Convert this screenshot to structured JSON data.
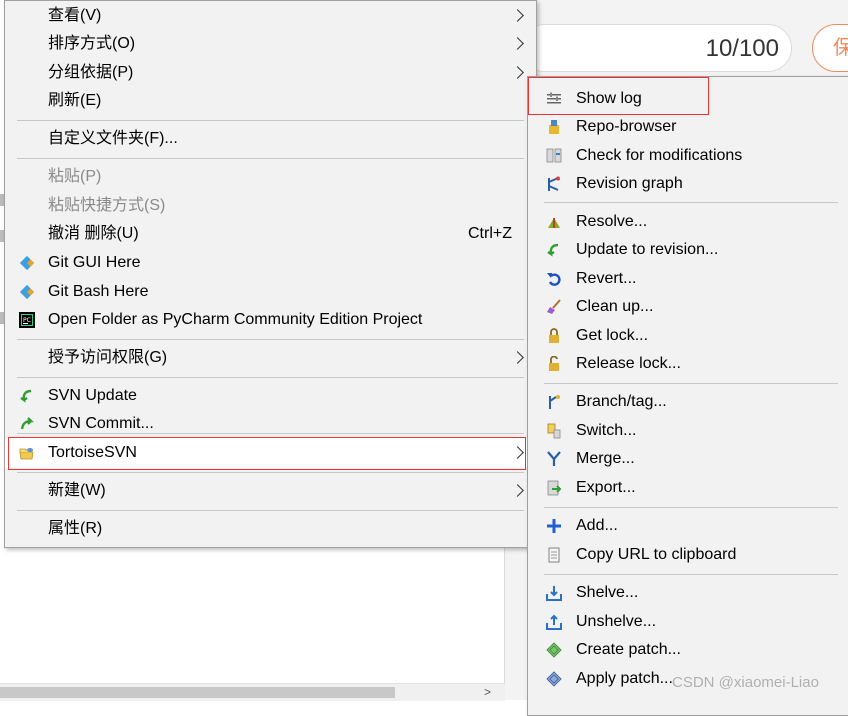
{
  "background": {
    "counter_text": "10/100",
    "save_button": "保"
  },
  "main_menu": [
    {
      "label": "查看(V)",
      "submenu": true
    },
    {
      "label": "排序方式(O)",
      "submenu": true
    },
    {
      "label": "分组依据(P)",
      "submenu": true
    },
    {
      "label": "刷新(E)"
    },
    {
      "label": "自定义文件夹(F)..."
    },
    {
      "label": "粘贴(P)",
      "disabled": true
    },
    {
      "label": "粘贴快捷方式(S)",
      "disabled": true
    },
    {
      "label": "撤消 删除(U)",
      "shortcut": "Ctrl+Z"
    },
    {
      "label": "Git GUI Here",
      "icon": "git-gui-icon"
    },
    {
      "label": "Git Bash Here",
      "icon": "git-bash-icon"
    },
    {
      "label": "Open Folder as PyCharm Community Edition Project",
      "icon": "pycharm-icon"
    },
    {
      "label": "授予访问权限(G)",
      "submenu": true
    },
    {
      "label": "SVN Update",
      "icon": "svn-update-icon"
    },
    {
      "label": "SVN Commit...",
      "icon": "svn-commit-icon"
    },
    {
      "label": "TortoiseSVN",
      "icon": "tortoisesvn-icon",
      "submenu": true,
      "highlighted": true
    },
    {
      "label": "新建(W)",
      "submenu": true
    },
    {
      "label": "属性(R)"
    }
  ],
  "svn_menu": [
    {
      "label": "Show log",
      "icon": "show-log-icon",
      "highlighted": true
    },
    {
      "label": "Repo-browser",
      "icon": "repo-browser-icon"
    },
    {
      "label": "Check for modifications",
      "icon": "check-modifications-icon"
    },
    {
      "label": "Revision graph",
      "icon": "revision-graph-icon"
    },
    {
      "label": "Resolve...",
      "icon": "resolve-icon"
    },
    {
      "label": "Update to revision...",
      "icon": "update-revision-icon"
    },
    {
      "label": "Revert...",
      "icon": "revert-icon"
    },
    {
      "label": "Clean up...",
      "icon": "cleanup-icon"
    },
    {
      "label": "Get lock...",
      "icon": "get-lock-icon"
    },
    {
      "label": "Release lock...",
      "icon": "release-lock-icon"
    },
    {
      "label": "Branch/tag...",
      "icon": "branch-tag-icon"
    },
    {
      "label": "Switch...",
      "icon": "switch-icon"
    },
    {
      "label": "Merge...",
      "icon": "merge-icon"
    },
    {
      "label": "Export...",
      "icon": "export-icon"
    },
    {
      "label": "Add...",
      "icon": "add-icon"
    },
    {
      "label": "Copy URL to clipboard",
      "icon": "copy-url-icon"
    },
    {
      "label": "Shelve...",
      "icon": "shelve-icon"
    },
    {
      "label": "Unshelve...",
      "icon": "unshelve-icon"
    },
    {
      "label": "Create patch...",
      "icon": "create-patch-icon"
    },
    {
      "label": "Apply patch...",
      "icon": "apply-patch-icon"
    }
  ],
  "watermark": "CSDN @xiaomei-Liao",
  "colors": {
    "menu_bg": "#f2f2f2",
    "highlight_border": "#e33333",
    "accent_orange": "#f08a5d"
  }
}
